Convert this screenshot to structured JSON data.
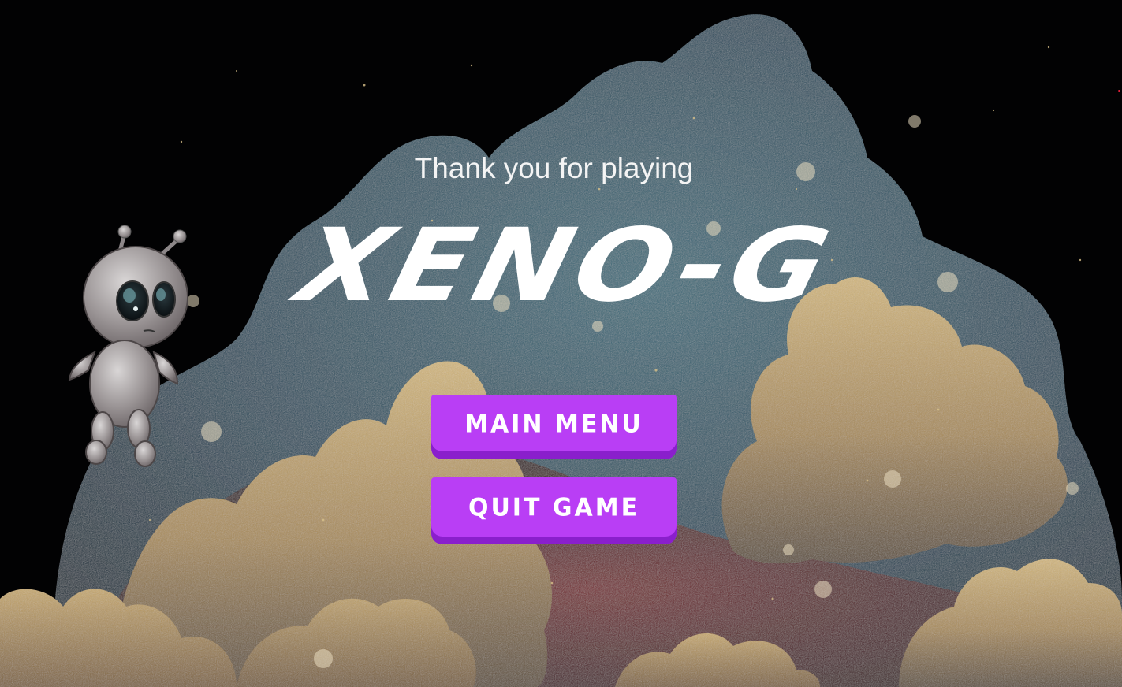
{
  "screen": {
    "subtitle": "Thank you for playing",
    "game_title": "XENO-G"
  },
  "buttons": {
    "main_menu": "MAIN MENU",
    "quit_game": "QUIT GAME"
  },
  "colors": {
    "button": "#b93ef5",
    "button_shadow": "#8a1fcc",
    "nebula_blue": "#2e5b6b",
    "nebula_gold": "#b79a62",
    "nebula_red": "#6a1e22",
    "background": "#020203"
  },
  "icons": {
    "character": "alien-robot-icon"
  }
}
